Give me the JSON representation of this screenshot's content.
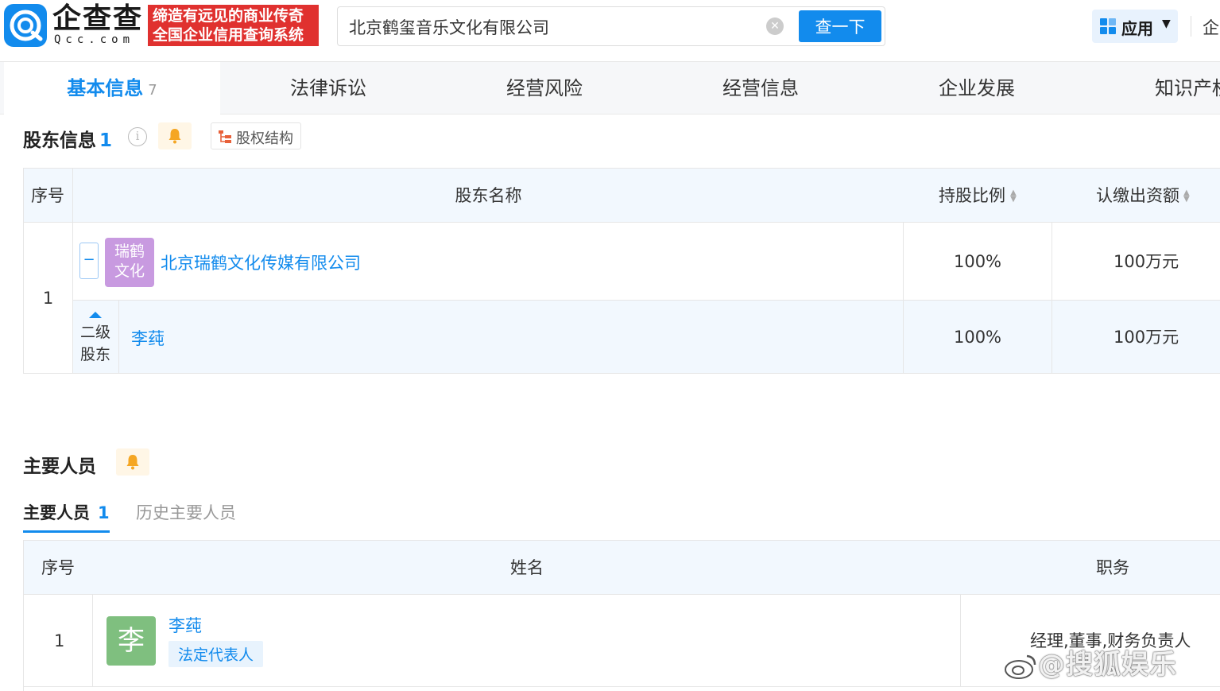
{
  "header": {
    "logo_text": "企查查",
    "logo_sub": "Qcc.com",
    "slogan_line1": "缔造有远见的商业传奇",
    "slogan_line2": "全国企业信用查询系统",
    "search_value": "北京鹤玺音乐文化有限公司",
    "search_button": "查一下",
    "apps_label": "应用",
    "more_label": "企"
  },
  "tabs": [
    {
      "label": "基本信息",
      "count": "7"
    },
    {
      "label": "法律诉讼"
    },
    {
      "label": "经营风险"
    },
    {
      "label": "经营信息"
    },
    {
      "label": "企业发展"
    },
    {
      "label": "知识产权"
    }
  ],
  "shareholders": {
    "title": "股东信息",
    "count": "1",
    "equity_button": "股权结构",
    "columns": [
      "序号",
      "股东名称",
      "持股比例",
      "认缴出资额"
    ],
    "rows": [
      {
        "index": "1",
        "logo_text_line1": "瑞鹤",
        "logo_text_line2": "文化",
        "toggle": "−",
        "name": "北京瑞鹤文化传媒有限公司",
        "ratio": "100%",
        "amount": "100万元",
        "sub": {
          "level_line1": "二级",
          "level_line2": "股东",
          "name": "李莼",
          "ratio": "100%",
          "amount": "100万元"
        }
      }
    ]
  },
  "personnel": {
    "title": "主要人员",
    "sub_tabs": [
      {
        "label": "主要人员",
        "count": "1"
      },
      {
        "label": "历史主要人员"
      }
    ],
    "columns": [
      "序号",
      "姓名",
      "职务"
    ],
    "rows": [
      {
        "index": "1",
        "avatar": "李",
        "name": "李莼",
        "tag": "法定代表人",
        "position": "经理,董事,财务负责人"
      }
    ]
  },
  "watermark": "@搜狐娱乐",
  "colors": {
    "accent": "#128bed",
    "slogan_bg": "#e0312f",
    "header_bg": "#f2f8fe"
  }
}
